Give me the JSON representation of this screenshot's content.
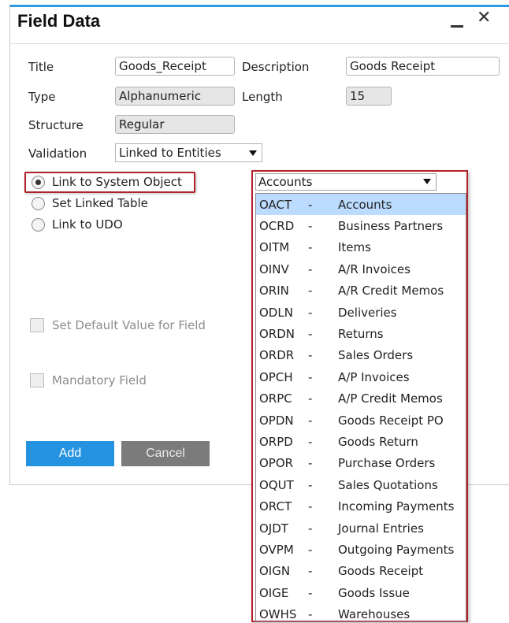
{
  "window": {
    "title": "Field Data",
    "minimize_icon": "minimize-icon",
    "close_symbol": "✕"
  },
  "form": {
    "title_label": "Title",
    "title_value": "Goods_Receipt",
    "description_label": "Description",
    "description_value": "Goods Receipt",
    "type_label": "Type",
    "type_value": "Alphanumeric",
    "length_label": "Length",
    "length_value": "15",
    "structure_label": "Structure",
    "structure_value": "Regular",
    "validation_label": "Validation",
    "validation_value": "Linked to Entities"
  },
  "link_options": [
    {
      "label": "Link to System Object",
      "checked": true
    },
    {
      "label": "Set Linked Table",
      "checked": false
    },
    {
      "label": "Link to UDO",
      "checked": false
    }
  ],
  "checkboxes": {
    "default_value": "Set Default Value for Field",
    "mandatory": "Mandatory Field"
  },
  "buttons": {
    "add": "Add",
    "cancel": "Cancel"
  },
  "object_dropdown": {
    "selected": "Accounts",
    "separator": "-",
    "items": [
      {
        "code": "OACT",
        "name": "Accounts"
      },
      {
        "code": "OCRD",
        "name": "Business Partners"
      },
      {
        "code": "OITM",
        "name": "Items"
      },
      {
        "code": "OINV",
        "name": "A/R Invoices"
      },
      {
        "code": "ORIN",
        "name": "A/R Credit Memos"
      },
      {
        "code": "ODLN",
        "name": "Deliveries"
      },
      {
        "code": "ORDN",
        "name": "Returns"
      },
      {
        "code": "ORDR",
        "name": "Sales Orders"
      },
      {
        "code": "OPCH",
        "name": "A/P Invoices"
      },
      {
        "code": "ORPC",
        "name": "A/P Credit Memos"
      },
      {
        "code": "OPDN",
        "name": "Goods Receipt PO"
      },
      {
        "code": "ORPD",
        "name": "Goods Return"
      },
      {
        "code": "OPOR",
        "name": "Purchase Orders"
      },
      {
        "code": "OQUT",
        "name": "Sales Quotations"
      },
      {
        "code": "ORCT",
        "name": "Incoming Payments"
      },
      {
        "code": "OJDT",
        "name": "Journal Entries"
      },
      {
        "code": "OVPM",
        "name": "Outgoing Payments"
      },
      {
        "code": "OIGN",
        "name": "Goods Receipt"
      },
      {
        "code": "OIGE",
        "name": "Goods Issue"
      },
      {
        "code": "OWHS",
        "name": "Warehouses"
      }
    ]
  },
  "colors": {
    "accent": "#2593e0",
    "highlight_border": "#b0232a",
    "selected_row": "#bcdcff"
  }
}
